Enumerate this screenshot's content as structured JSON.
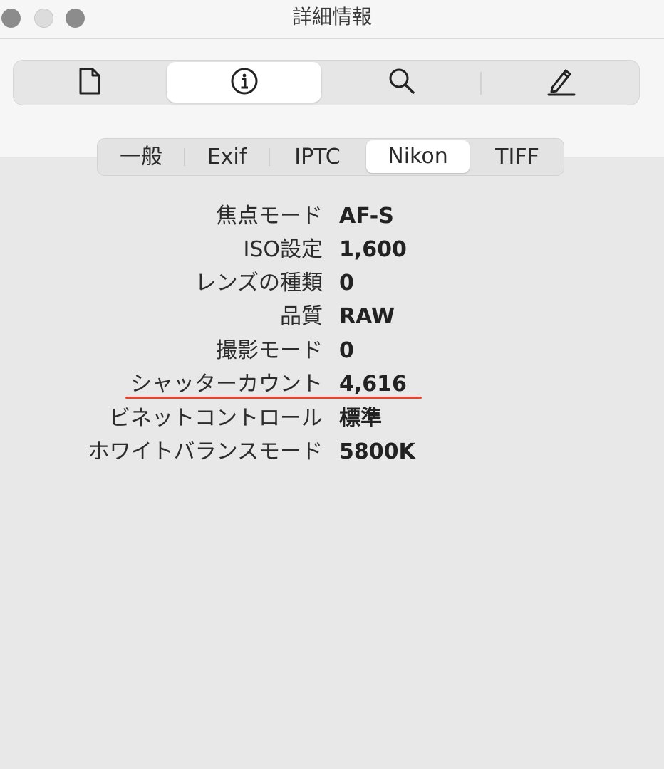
{
  "window": {
    "title": "詳細情報"
  },
  "toolbar": {
    "buttons": [
      {
        "name": "document-icon",
        "selected": false
      },
      {
        "name": "info-icon",
        "selected": true
      },
      {
        "name": "search-icon",
        "selected": false
      },
      {
        "name": "pencil-icon",
        "selected": false
      }
    ]
  },
  "tabs": [
    {
      "label": "一般",
      "selected": false
    },
    {
      "label": "Exif",
      "selected": false
    },
    {
      "label": "IPTC",
      "selected": false
    },
    {
      "label": "Nikon",
      "selected": true
    },
    {
      "label": "TIFF",
      "selected": false
    }
  ],
  "rows": [
    {
      "label": "焦点モード",
      "value": "AF-S"
    },
    {
      "label": "ISO設定",
      "value": "1,600"
    },
    {
      "label": "レンズの種類",
      "value": "0"
    },
    {
      "label": "品質",
      "value": "RAW"
    },
    {
      "label": "撮影モード",
      "value": "0"
    },
    {
      "label": "シャッターカウント",
      "value": "4,616"
    },
    {
      "label": "ビネットコントロール",
      "value": "標準"
    },
    {
      "label": "ホワイトバランスモード",
      "value": "5800K"
    }
  ],
  "colors": {
    "annotation": "#e8432e",
    "background": "#e8e8e8"
  }
}
